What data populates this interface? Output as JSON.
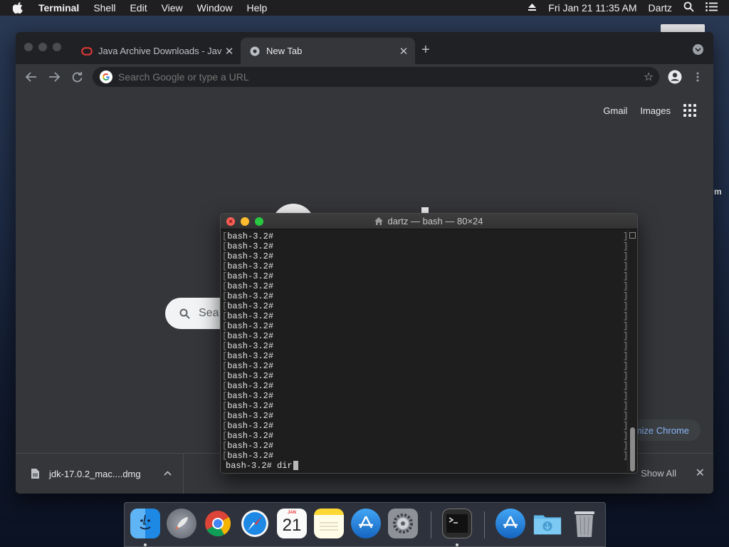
{
  "menubar": {
    "app_name": "Terminal",
    "items": [
      "Shell",
      "Edit",
      "View",
      "Window",
      "Help"
    ],
    "datetime": "Fri Jan 21  11:35 AM",
    "user": "Dartz"
  },
  "chrome": {
    "tabs": [
      {
        "title": "Java Archive Downloads - Java",
        "active": false
      },
      {
        "title": "New Tab",
        "active": true
      }
    ],
    "omnibox": {
      "placeholder": "Search Google or type a URL",
      "value": ""
    },
    "new_tab_page": {
      "links": [
        "Gmail",
        "Images"
      ],
      "search_placeholder": "Sea",
      "customize_label": "mize Chrome"
    },
    "downloads": {
      "file_name": "jdk-17.0.2_mac....dmg",
      "show_all": "Show All"
    }
  },
  "terminal": {
    "title": "dartz — bash — 80×24",
    "prompt": "bash-3.2# ",
    "history_lines": 23,
    "current_input": "dir"
  },
  "desktop": {
    "edge_text": "m"
  },
  "dock": {
    "calendar": {
      "month": "JAN",
      "day": "21"
    },
    "icons": [
      "finder-icon",
      "launchpad-icon",
      "chrome-icon",
      "safari-icon",
      "calendar-icon",
      "notes-icon",
      "app-store-icon",
      "system-preferences-icon",
      "terminal-icon",
      "app-store-icon",
      "downloads-folder-icon",
      "trash-icon"
    ]
  },
  "colors": {
    "chrome_dark": "#35363a",
    "chrome_tabstrip": "#202124",
    "terminal_bg": "#1e1e1e",
    "close_red": "#fe5f57",
    "minimize_yellow": "#febc2e",
    "zoom_green": "#28c840",
    "link_blue": "#8ab4f8"
  }
}
